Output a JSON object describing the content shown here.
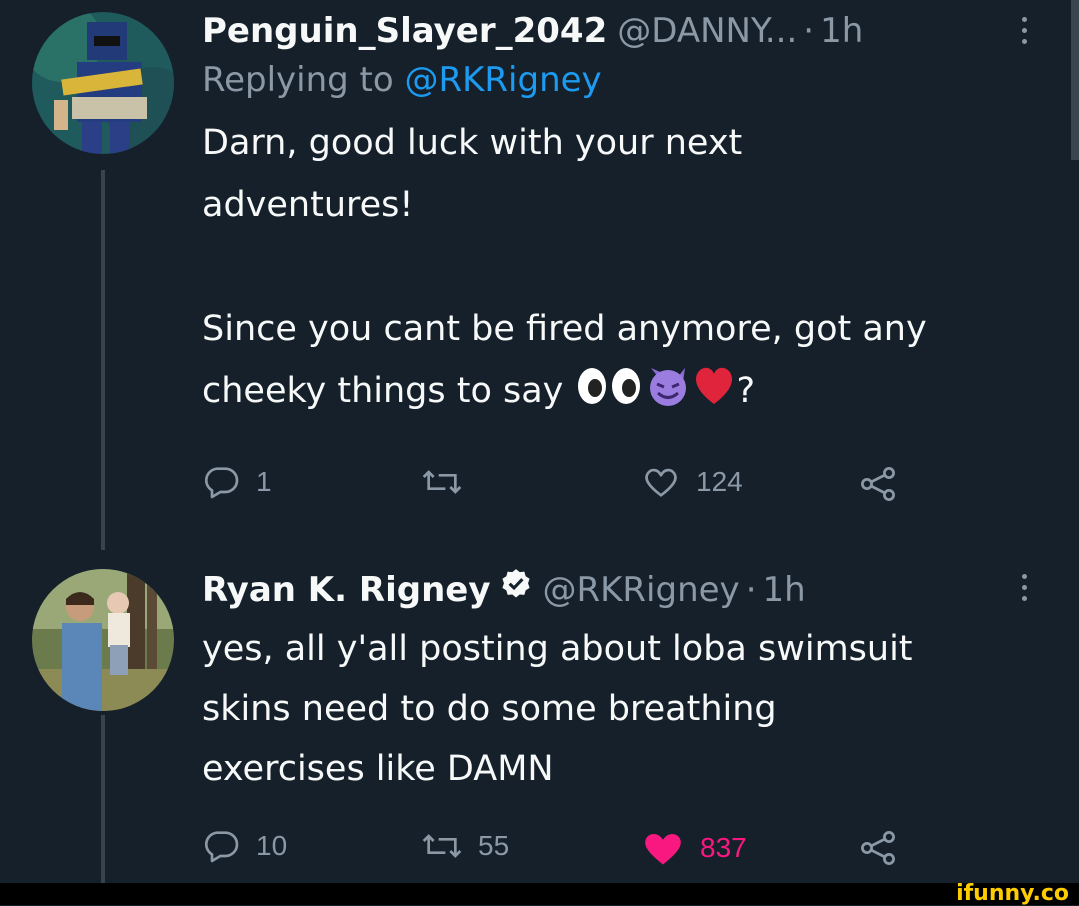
{
  "tweet1": {
    "display_name": "Penguin_Slayer_2042",
    "handle": "@DANNY...",
    "separator": "·",
    "time": "1h",
    "reply_prefix": "Replying to ",
    "reply_mention": "@RKRigney",
    "body_para1": "Darn, good luck with your next\nadventures!",
    "body_para2_text": "Since you cant be fired anymore, got any\ncheeky things to say ",
    "body_para2_end": "?",
    "emojis": [
      "eyes-emoji",
      "smiling-imp-emoji",
      "red-heart-emoji"
    ],
    "replies": "1",
    "retweets": "",
    "likes": "124",
    "liked": false
  },
  "tweet2": {
    "display_name": "Ryan K. Rigney",
    "handle": "@RKRigney",
    "separator": "·",
    "time": "1h",
    "verified": true,
    "body": "yes, all y'all posting about loba swimsuit\nskins need to do some breathing\nexercises like DAMN",
    "replies": "10",
    "retweets": "55",
    "likes": "837",
    "liked": true
  },
  "colors": {
    "background": "#15202b",
    "text": "#f7f9f9",
    "muted": "#8b98a5",
    "link": "#1d9bf0",
    "like": "#f91880",
    "watermark": "#ffcc00"
  },
  "watermark": "ifunny.co"
}
